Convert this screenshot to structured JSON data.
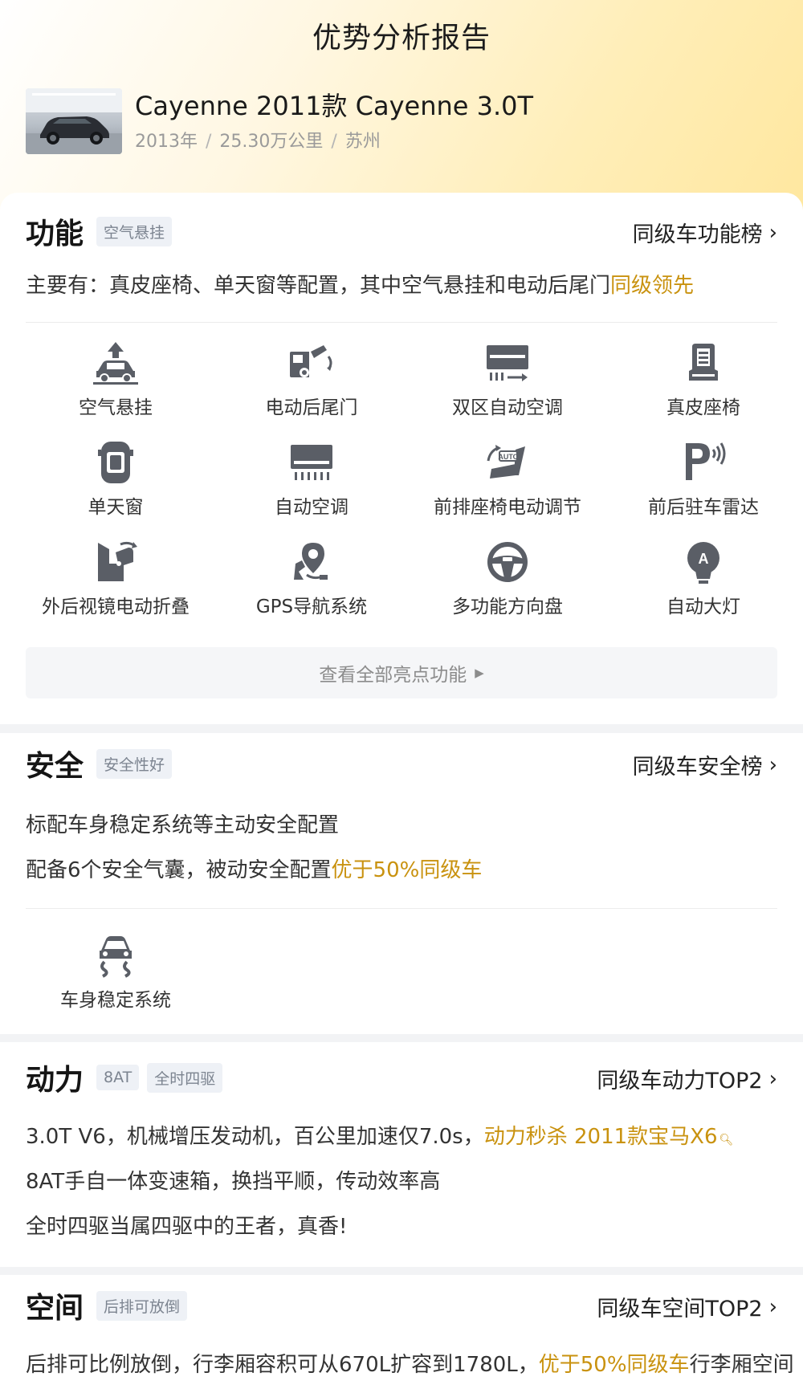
{
  "header": {
    "title": "优势分析报告"
  },
  "car": {
    "name": "Cayenne 2011款 Cayenne 3.0T",
    "year": "2013年",
    "mileage": "25.30万公里",
    "city": "苏州",
    "separator": "/"
  },
  "features_section": {
    "title": "功能",
    "tag": "空气悬挂",
    "rank_link": "同级车功能榜",
    "desc_prefix": "主要有：真皮座椅、单天窗等配置，其中空气悬挂和电动后尾门",
    "desc_highlight": "同级领先",
    "items": [
      {
        "label": "空气悬挂",
        "icon": "air-suspension-icon"
      },
      {
        "label": "电动后尾门",
        "icon": "power-tailgate-icon"
      },
      {
        "label": "双区自动空调",
        "icon": "dual-zone-ac-icon"
      },
      {
        "label": "真皮座椅",
        "icon": "leather-seat-icon"
      },
      {
        "label": "单天窗",
        "icon": "sunroof-icon"
      },
      {
        "label": "自动空调",
        "icon": "auto-ac-icon"
      },
      {
        "label": "前排座椅电动调节",
        "icon": "power-seat-icon"
      },
      {
        "label": "前后驻车雷达",
        "icon": "parking-radar-icon"
      },
      {
        "label": "外后视镜电动折叠",
        "icon": "mirror-fold-icon"
      },
      {
        "label": "GPS导航系统",
        "icon": "gps-icon"
      },
      {
        "label": "多功能方向盘",
        "icon": "steering-wheel-icon"
      },
      {
        "label": "自动大灯",
        "icon": "auto-headlight-icon"
      }
    ],
    "view_all": "查看全部亮点功能"
  },
  "safety_section": {
    "title": "安全",
    "tag": "安全性好",
    "rank_link": "同级车安全榜",
    "line1": "标配车身稳定系统等主动安全配置",
    "line2_prefix": "配备6个安全气囊，被动安全配置",
    "line2_highlight": "优于50%同级车",
    "items": [
      {
        "label": "车身稳定系统",
        "icon": "stability-control-icon"
      }
    ]
  },
  "power_section": {
    "title": "动力",
    "tags": [
      "8AT",
      "全时四驱"
    ],
    "rank_link": "同级车动力TOP2",
    "line1_prefix": "3.0T V6，机械增压发动机，百公里加速仅7.0s，",
    "line1_highlight": "动力秒杀 2011款宝马X6",
    "line2": "8AT手自一体变速箱，换挡平顺，传动效率高",
    "line3": "全时四驱当属四驱中的王者，真香!"
  },
  "space_section": {
    "title": "空间",
    "tag": "后排可放倒",
    "rank_link": "同级车空间TOP2",
    "line1_prefix": "后排可比例放倒，行李厢容积可从670L扩容到1780L，",
    "line1_highlight": "优于50%同级车",
    "line1_suffix": "行李厢空间"
  },
  "colors": {
    "accent": "#c9920f",
    "icon": "#5a5e66"
  }
}
